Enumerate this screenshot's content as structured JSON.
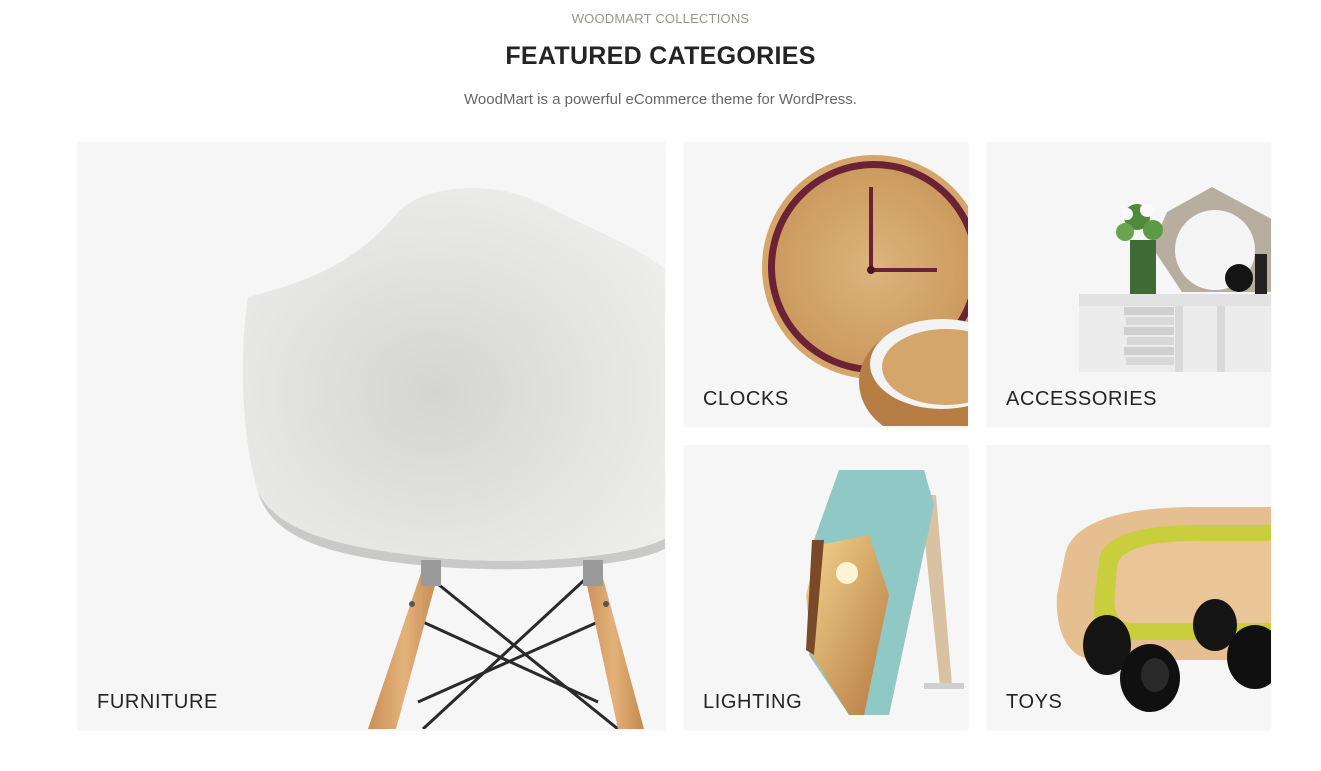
{
  "section": {
    "subtitle": "WOODMART COLLECTIONS",
    "title": "FEATURED CATEGORIES",
    "description": "WoodMart is a powerful eCommerce theme for WordPress."
  },
  "categories": [
    {
      "label": "FURNITURE",
      "icon": "chair-image"
    },
    {
      "label": "CLOCKS",
      "icon": "clock-image"
    },
    {
      "label": "ACCESSORIES",
      "icon": "shelf-decor-image"
    },
    {
      "label": "LIGHTING",
      "icon": "lamp-image"
    },
    {
      "label": "TOYS",
      "icon": "toy-car-image"
    }
  ],
  "colors": {
    "accent": "#8f9a86",
    "card_background": "#f6f6f6",
    "text": "#242424"
  }
}
